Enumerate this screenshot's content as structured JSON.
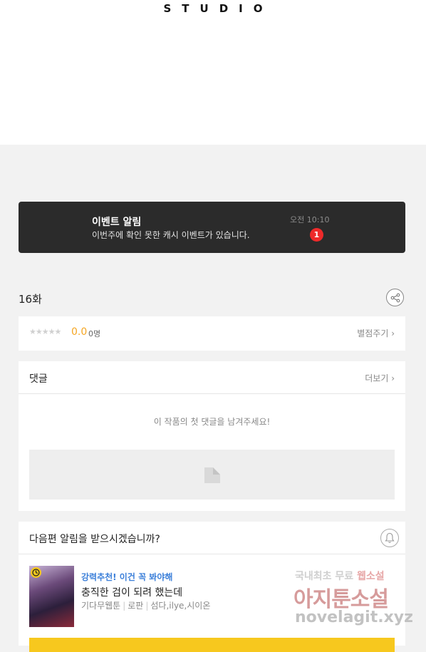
{
  "header": {
    "logo_text": "STUDIO"
  },
  "event_banner": {
    "title": "이벤트 알림",
    "description": "이번주에 확인 못한 캐시 이벤트가 있습니다.",
    "time": "오전 10:10",
    "badge_count": "1"
  },
  "episode": {
    "title": "16화"
  },
  "rating": {
    "stars": "★★★★★",
    "score": "0.0",
    "count": "0명",
    "rate_link": "별점주기 ›"
  },
  "comments": {
    "header": "댓글",
    "more_link": "더보기 ›",
    "empty_message": "이 작품의 첫 댓글을 남겨주세요!"
  },
  "notify": {
    "question": "다음편 알림을 받으시겠습니까?"
  },
  "recommendation": {
    "headline": "강력추천! 이건 꼭 봐야해",
    "title": "충직한 검이 되려 했는데",
    "platform": "기다무웹툰",
    "genre": "로판",
    "authors": "섬다,ilye,시이온"
  },
  "watermark": {
    "line1_part1": "국내최초 무료",
    "line1_part2": "웹소설",
    "line2": "아지툰소설",
    "line3": "novelagit.xyz"
  },
  "colors": {
    "banner_bg": "#2b2b2b",
    "badge_red": "#ee2a2a",
    "score_orange": "#f5a623",
    "rec_blue": "#3b7fd9",
    "button_yellow": "#f7c81e"
  }
}
